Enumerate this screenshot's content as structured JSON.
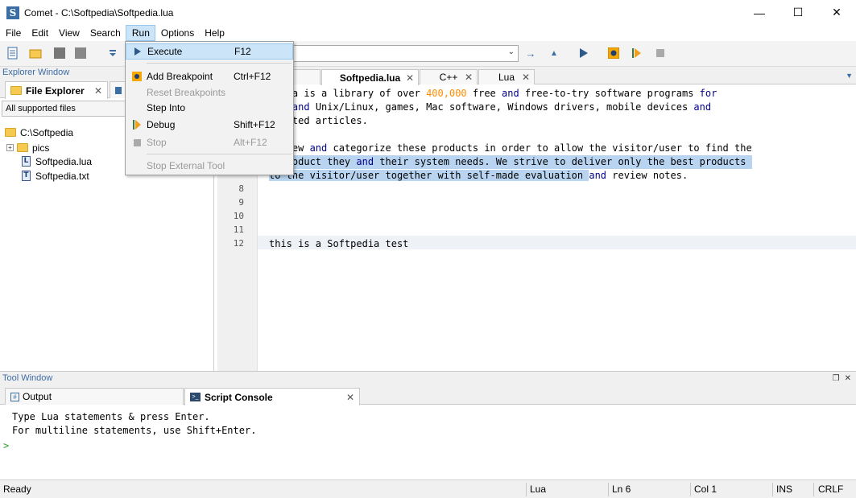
{
  "window": {
    "title": "Comet - C:\\Softpedia\\Softpedia.lua",
    "app_icon": "S"
  },
  "menu": {
    "items": [
      "File",
      "Edit",
      "View",
      "Search",
      "Run",
      "Options",
      "Help"
    ],
    "active": "Run"
  },
  "run_menu": [
    {
      "label": "Execute",
      "shortcut": "F12",
      "icon": "play-icon",
      "enabled": true,
      "hover": true
    },
    {
      "label": "Add Breakpoint",
      "shortcut": "Ctrl+F12",
      "icon": "breakpoint-icon",
      "enabled": true
    },
    {
      "label": "Reset Breakpoints",
      "shortcut": "",
      "enabled": false
    },
    {
      "label": "Step Into",
      "shortcut": "",
      "enabled": true
    },
    {
      "label": "Debug",
      "shortcut": "Shift+F12",
      "icon": "debug-icon",
      "enabled": true
    },
    {
      "label": "Stop",
      "shortcut": "Alt+F12",
      "icon": "stop-icon",
      "enabled": false
    },
    {
      "label": "Stop External Tool",
      "shortcut": "",
      "enabled": false
    }
  ],
  "explorer": {
    "caption": "Explorer Window",
    "tab_label": "File Explorer",
    "filter": "All supported files",
    "tree": {
      "root": "C:\\Softpedia",
      "children": [
        {
          "name": "pics",
          "type": "folder"
        },
        {
          "name": "Softpedia.lua",
          "type": "file",
          "badge": "L"
        },
        {
          "name": "Softpedia.txt",
          "type": "file",
          "badge": "T"
        }
      ]
    }
  },
  "editor": {
    "tabs": [
      {
        "label": "Softpedia.lua",
        "selected": true
      },
      {
        "label": "C++",
        "selected": false
      },
      {
        "label": "Lua",
        "selected": false
      }
    ],
    "line_numbers": [
      "8",
      "9",
      "10",
      "11",
      "12"
    ],
    "lines": [
      {
        "t1": "pedia is a library of over ",
        "n1": "400,000",
        "t2": " free ",
        "k1": "and",
        "t3": " free-to-try software programs ",
        "k2": "for"
      },
      {
        "t1": "ows ",
        "k1": "and",
        "t2": " Unix/Linux, games, Mac software, Windows drivers, mobile devices ",
        "k2": "and"
      },
      {
        "t1": "related articles."
      },
      {
        "t1": ""
      },
      {
        "t1": "review ",
        "k1": "and",
        "t2": " categorize these products in order to allow the visitor/user to find the"
      },
      {
        "t1": "t product they ",
        "k1": "and",
        "t2": " their system needs. We strive to deliver only the best products "
      },
      {
        "t1": "to the visitor/user together with self-made evaluation ",
        "k1": "and",
        "t2": " review notes."
      },
      {
        "t1": "this is a Softpedia test"
      }
    ]
  },
  "toolwindow": {
    "caption": "Tool Window",
    "tabs": [
      {
        "label": "Output",
        "selected": false
      },
      {
        "label": "Script Console",
        "selected": true
      }
    ],
    "console_lines": [
      "Type Lua statements & press Enter.",
      "For multiline statements, use Shift+Enter."
    ],
    "prompt": ">"
  },
  "status": {
    "state": "Ready",
    "language": "Lua",
    "line": "Ln 6",
    "col": "Col 1",
    "mode": "INS",
    "eol": "CRLF"
  }
}
